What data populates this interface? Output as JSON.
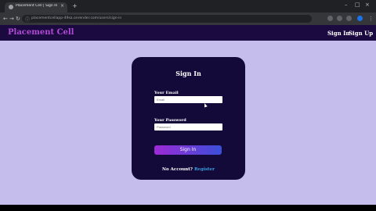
{
  "browser": {
    "tab_title": "Placement Cell | Sign In",
    "tab_close": "×",
    "new_tab": "+",
    "url": "placementcellapp-49sa.onrender.com/users/sign-in",
    "lock": "ⓘ",
    "back": "←",
    "forward": "→",
    "reload": "↻",
    "min": "–",
    "max": "□",
    "close": "×"
  },
  "site": {
    "brand": "Placement Cell",
    "nav": {
      "sign_in": "Sign In",
      "sign_up": "Sign Up"
    }
  },
  "form": {
    "title": "Sign In",
    "email_label": "Your Email",
    "email_placeholder": "Email",
    "password_label": "Your Password",
    "password_placeholder": "Password",
    "submit": "Sign In",
    "footer_text": "No Account?",
    "register": "Register"
  },
  "colors": {
    "page_bg": "#c5bdeb",
    "nav_bg": "#1b0a3f",
    "card_bg": "#130a3a",
    "brand": "#b24ad6",
    "register_link": "#3aa0e0"
  }
}
